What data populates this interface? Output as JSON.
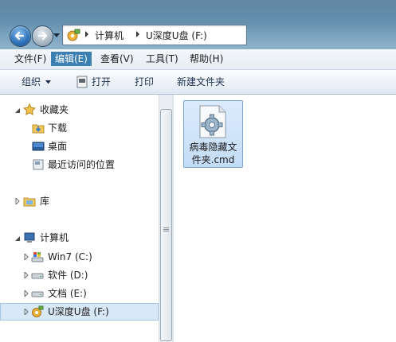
{
  "address": {
    "segments": [
      "计算机",
      "U深度U盘 (F:)"
    ]
  },
  "menu": [
    {
      "label": "文件(F)",
      "active": false
    },
    {
      "label": "编辑(E)",
      "active": true
    },
    {
      "label": "查看(V)",
      "active": false
    },
    {
      "label": "工具(T)",
      "active": false
    },
    {
      "label": "帮助(H)",
      "active": false
    }
  ],
  "commands": {
    "organize": "组织",
    "open": "打开",
    "print": "打印",
    "new_folder": "新建文件夹"
  },
  "nav": {
    "favorites": {
      "label": "收藏夹",
      "items": [
        "下载",
        "桌面",
        "最近访问的位置"
      ]
    },
    "libraries": {
      "label": "库"
    },
    "computer": {
      "label": "计算机",
      "drives": [
        "Win7 (C:)",
        "软件 (D:)",
        "文档 (E:)",
        "U深度U盘 (F:)"
      ]
    }
  },
  "files": [
    {
      "name": "病毒隐藏文件夹.cmd",
      "icon": "cmd-gear-icon"
    }
  ],
  "colors": {
    "selection": "#d9e8f7",
    "active_menu": "#3c7fb1"
  }
}
